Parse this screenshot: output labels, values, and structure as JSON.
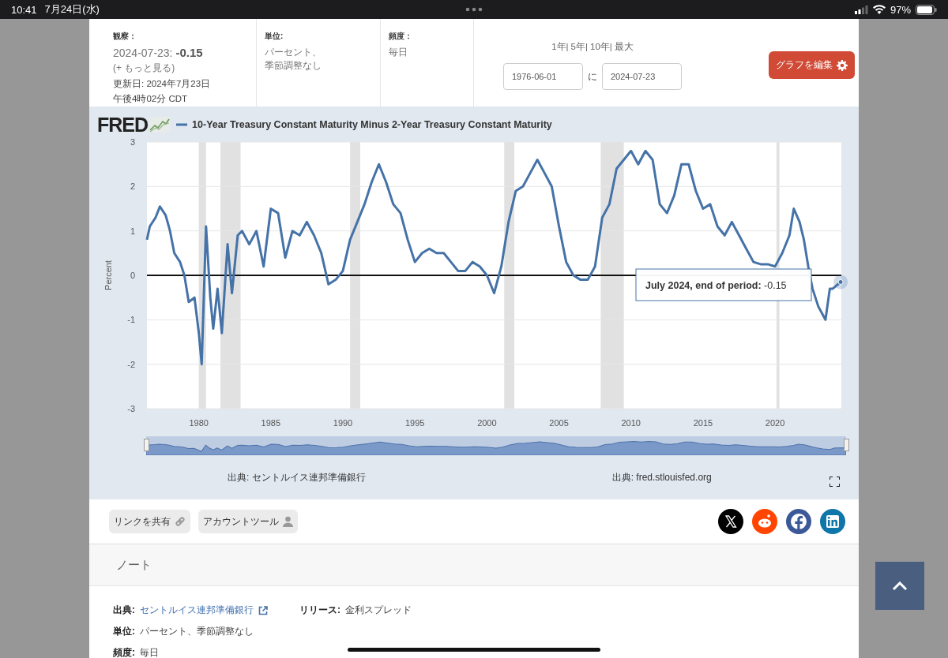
{
  "status_bar": {
    "time": "10:41",
    "date": "7月24日(水)",
    "battery": "97%"
  },
  "header": {
    "observation": {
      "label": "観察：",
      "date": "2024-07-23:",
      "value": "-0.15",
      "more": "(+ もっと見る)",
      "updated": "更新日: 2024年7月23日",
      "time": "午後4時02分 CDT"
    },
    "units": {
      "label": "単位:",
      "lines": [
        "パーセント、",
        "季節調整なし"
      ]
    },
    "frequency": {
      "label": "頻度：",
      "value": "毎日"
    },
    "range_links": [
      {
        "label": "1年",
        "separator": "|"
      },
      {
        "label": "5年",
        "separator": "|"
      },
      {
        "label": "10年",
        "separator": "|"
      },
      {
        "label": "最大"
      }
    ],
    "date_range": {
      "start": "1976-06-01",
      "joiner": "に",
      "end": "2024-07-23"
    },
    "edit_button": "グラフを編集"
  },
  "chart": {
    "logo": "FRED",
    "tooltip": {
      "label": "July 2024, end of period:",
      "value": "-0.15"
    },
    "chart_data": {
      "type": "line",
      "grid": true,
      "ylabel": "Percent",
      "xlim": [
        1976.4,
        2024.6
      ],
      "ylim": [
        -3,
        3
      ],
      "yticks": [
        3,
        2,
        1,
        0,
        -1,
        -2,
        -3
      ],
      "xticks": [
        1980,
        1985,
        1990,
        1995,
        2000,
        2005,
        2010,
        2015,
        2020
      ],
      "x": [
        1976.4,
        1976.6,
        1977,
        1977.3,
        1977.7,
        1978,
        1978.3,
        1978.7,
        1979,
        1979.3,
        1979.7,
        1980,
        1980.2,
        1980.5,
        1980.8,
        1981,
        1981.3,
        1981.6,
        1982,
        1982.3,
        1982.7,
        1983,
        1983.5,
        1984,
        1984.5,
        1985,
        1985.5,
        1986,
        1986.5,
        1987,
        1987.5,
        1988,
        1988.5,
        1989,
        1989.5,
        1990,
        1990.5,
        1991,
        1991.5,
        1992,
        1992.5,
        1993,
        1993.5,
        1994,
        1994.5,
        1995,
        1995.5,
        1996,
        1996.5,
        1997,
        1997.5,
        1998,
        1998.5,
        1999,
        1999.5,
        2000,
        2000.5,
        2001,
        2001.5,
        2002,
        2002.5,
        2003,
        2003.5,
        2004,
        2004.5,
        2005,
        2005.5,
        2006,
        2006.5,
        2007,
        2007.5,
        2008,
        2008.5,
        2009,
        2009.5,
        2010,
        2010.5,
        2011,
        2011.5,
        2012,
        2012.5,
        2013,
        2013.5,
        2014,
        2014.5,
        2015,
        2015.5,
        2016,
        2016.5,
        2017,
        2017.5,
        2018,
        2018.5,
        2019,
        2019.5,
        2020,
        2020.5,
        2021,
        2021.3,
        2021.7,
        2022,
        2022.3,
        2022.6,
        2023,
        2023.5,
        2023.8,
        2024,
        2024.55
      ],
      "series": [
        {
          "name": "10-Year Treasury Constant Maturity Minus 2-Year Treasury Constant Maturity",
          "color": "#4572a7",
          "values": [
            0.8,
            1.1,
            1.3,
            1.55,
            1.35,
            1.0,
            0.5,
            0.3,
            0.0,
            -0.6,
            -0.5,
            -1.3,
            -2.0,
            1.1,
            -0.5,
            -1.2,
            -0.3,
            -1.3,
            0.7,
            -0.4,
            0.9,
            1.0,
            0.7,
            1.0,
            0.2,
            1.5,
            1.4,
            0.4,
            1.0,
            0.9,
            1.2,
            0.9,
            0.5,
            -0.2,
            -0.1,
            0.1,
            0.8,
            1.2,
            1.6,
            2.1,
            2.5,
            2.1,
            1.6,
            1.4,
            0.8,
            0.3,
            0.5,
            0.6,
            0.5,
            0.5,
            0.3,
            0.1,
            0.1,
            0.3,
            0.2,
            0.0,
            -0.4,
            0.2,
            1.2,
            1.9,
            2.0,
            2.3,
            2.6,
            2.3,
            2.0,
            1.1,
            0.3,
            0.0,
            -0.1,
            -0.1,
            0.2,
            1.3,
            1.6,
            2.4,
            2.6,
            2.8,
            2.5,
            2.8,
            2.6,
            1.6,
            1.4,
            1.8,
            2.5,
            2.5,
            1.9,
            1.5,
            1.6,
            1.1,
            0.9,
            1.2,
            0.9,
            0.6,
            0.3,
            0.25,
            0.25,
            0.2,
            0.5,
            0.9,
            1.5,
            1.2,
            0.8,
            0.2,
            -0.3,
            -0.7,
            -1.0,
            -0.3,
            -0.3,
            -0.15
          ]
        }
      ],
      "bands": [
        {
          "axis": "x",
          "from": 1980,
          "to": 1980.5
        },
        {
          "axis": "x",
          "from": 1981.5,
          "to": 1982.9
        },
        {
          "axis": "x",
          "from": 1990.5,
          "to": 1991.2
        },
        {
          "axis": "x",
          "from": 2001.2,
          "to": 2001.9
        },
        {
          "axis": "x",
          "from": 2007.9,
          "to": 2009.5
        },
        {
          "axis": "x",
          "from": 2020.1,
          "to": 2020.3
        }
      ]
    },
    "sources": [
      "出典: セントルイス連邦準備銀行",
      "出典: fred.stlouisfed.org"
    ]
  },
  "share_buttons": [
    {
      "label": "リンクを共有",
      "kind": "link"
    },
    {
      "label": "アカウントツール",
      "kind": "account"
    }
  ],
  "notes": {
    "heading": "ノート",
    "lines": [
      [
        {
          "label": "出典:",
          "value": "セントルイス連邦準備銀行",
          "link": true
        },
        {
          "label": "リリース:",
          "value": "金利スプレッド",
          "link": false
        }
      ],
      [
        {
          "label": "単位:",
          "value": "パーセント、季節調整なし",
          "link": false
        }
      ],
      [
        {
          "label": "頻度:",
          "value": "毎日",
          "link": false
        }
      ]
    ]
  }
}
